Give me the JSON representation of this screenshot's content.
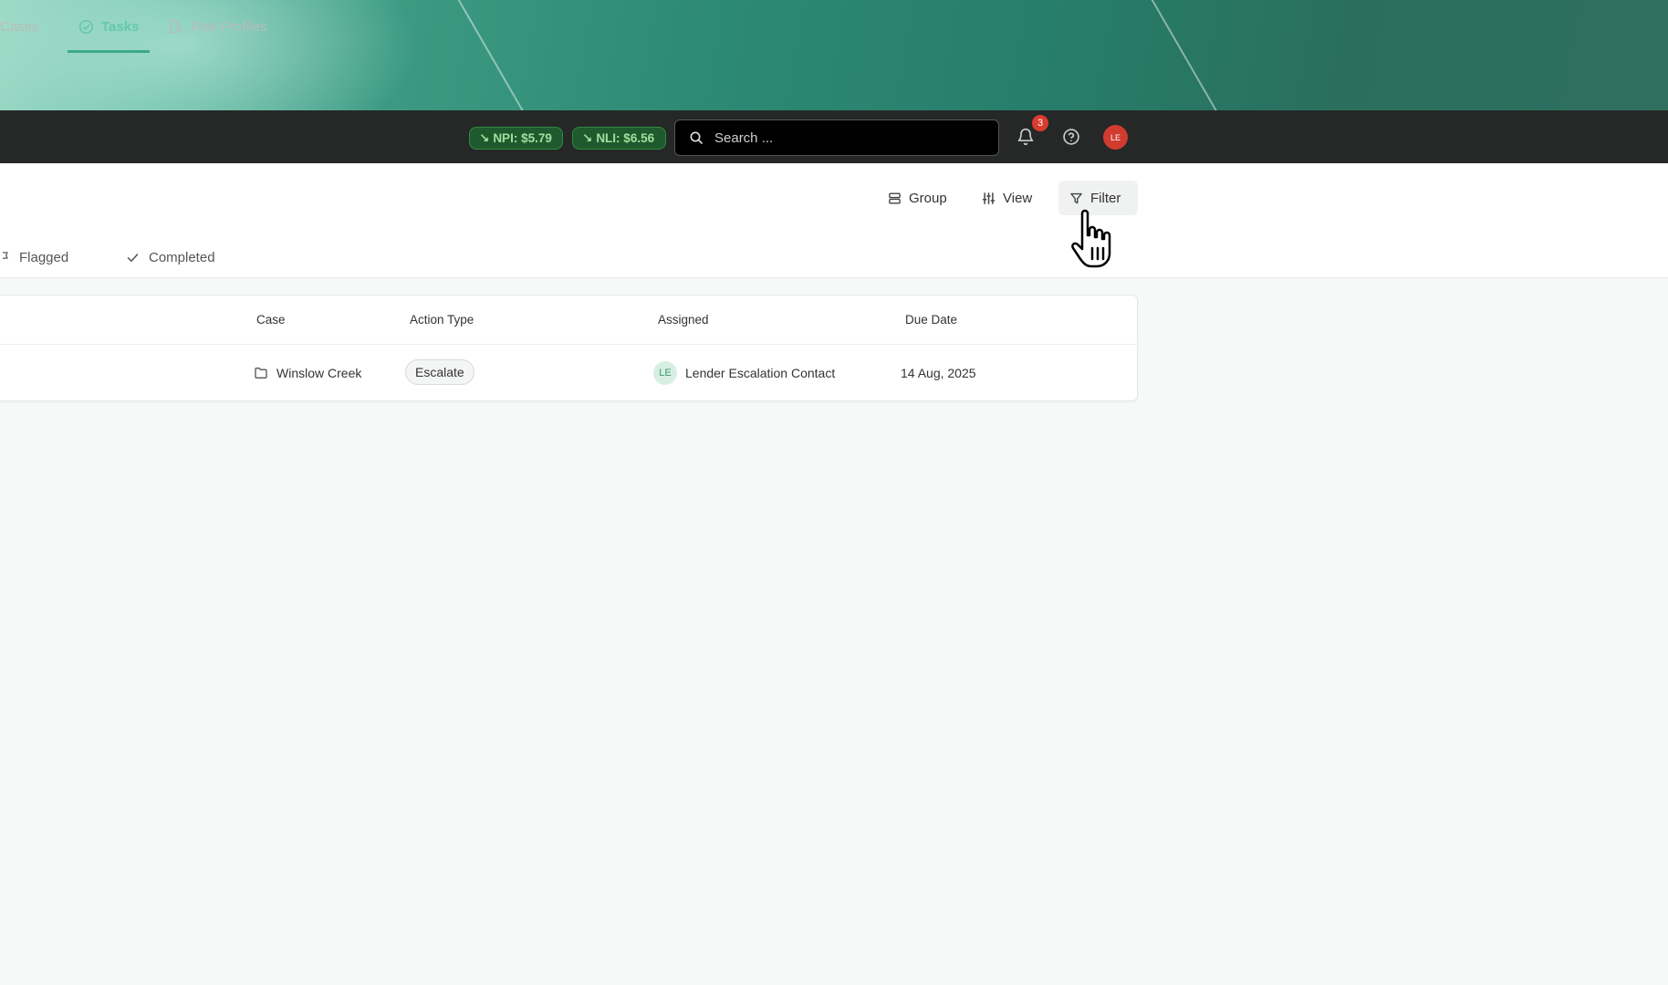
{
  "nav": {
    "cases_label": "Cases",
    "tasks_label": "Tasks",
    "risk_profiles_label": "Risk Profiles",
    "active_color": "#63c9a6"
  },
  "tickers": {
    "npi_label": "NPI: $5.79",
    "nli_label": "NLI: $6.56",
    "color": "#9fe09e"
  },
  "search": {
    "placeholder": "Search ..."
  },
  "notifications": {
    "count": "3"
  },
  "user": {
    "initials": "LE"
  },
  "toolbar": {
    "group_label": "Group",
    "view_label": "View",
    "filter_label": "Filter"
  },
  "tabs": {
    "flagged_label": "Flagged",
    "completed_label": "Completed"
  },
  "table": {
    "headers": {
      "case": "Case",
      "action_type": "Action Type",
      "assigned": "Assigned",
      "due_date": "Due Date"
    },
    "rows": [
      {
        "case": "Winslow Creek",
        "action_type": "Escalate",
        "assignee_initials": "LE",
        "assignee": "Lender Escalation Contact",
        "due_date": "14 Aug, 2025"
      }
    ]
  }
}
